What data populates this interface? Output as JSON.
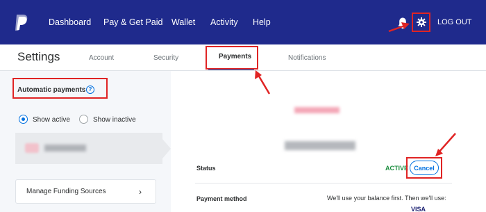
{
  "nav": {
    "items": [
      "Dashboard",
      "Pay & Get Paid",
      "Wallet",
      "Activity",
      "Help"
    ],
    "logout_label": "LOG OUT",
    "icons": {
      "logo": "paypal-logo",
      "bell": "bell-icon",
      "settings": "gear-icon"
    },
    "background": "#1f2a8c"
  },
  "settings": {
    "title": "Settings",
    "tabs": [
      "Account",
      "Security",
      "Payments",
      "Notifications"
    ],
    "active_tab": "Payments"
  },
  "automatic_payments": {
    "heading": "Automatic payments",
    "help_glyph": "?",
    "filters": {
      "active": "Show active",
      "inactive": "Show inactive",
      "selected": "Show active"
    }
  },
  "funding": {
    "label": "Manage Funding Sources",
    "chevron": "›"
  },
  "detail": {
    "status_label": "Status",
    "status_value": "ACTIVE",
    "cancel_label": "Cancel",
    "payment_method_label": "Payment method",
    "payment_method_text": "We'll use your balance first. Then we'll use:",
    "card_brand": "VISA"
  },
  "colors": {
    "accent": "#0070e0",
    "annotation": "#e02424",
    "status_active": "#1a8d3d"
  }
}
